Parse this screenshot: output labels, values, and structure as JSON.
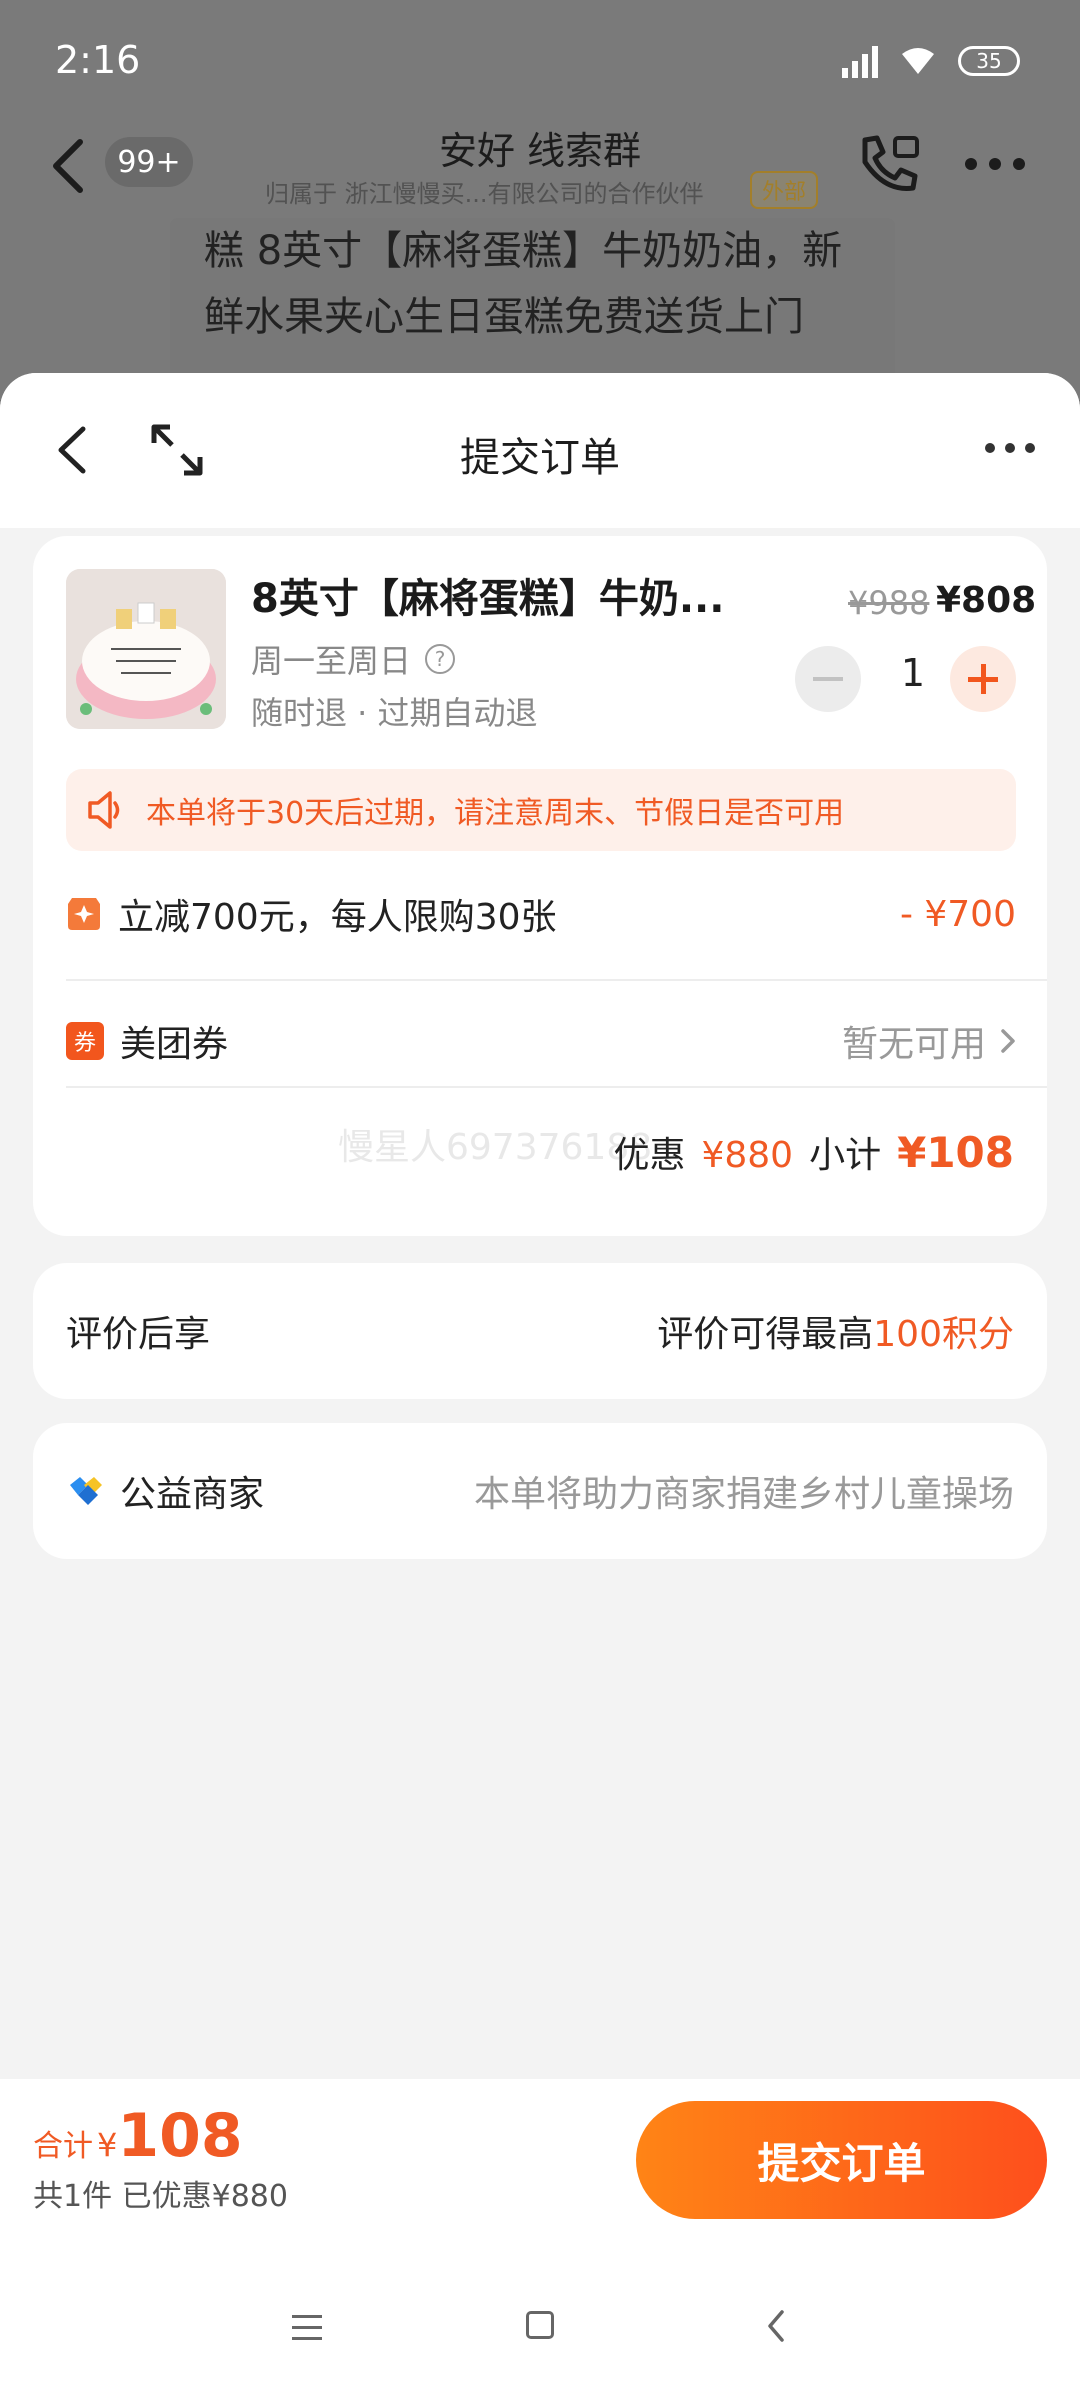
{
  "status_bar": {
    "time": "2:16",
    "battery": "35"
  },
  "chat": {
    "unread_count": "99+",
    "title": "安好 线索群",
    "subtitle": "归属于 浙江慢慢买...有限公司的合作伙伴",
    "external_tag": "外部",
    "bubble_text": "糕 8英寸【麻将蛋糕】牛奶奶油，新鲜水果夹心生日蛋糕免费送货上门"
  },
  "sheet": {
    "title": "提交订单"
  },
  "product": {
    "name": "8英寸【麻将蛋糕】牛奶...",
    "availability": "周一至周日",
    "refund_policy": "随时退 · 过期自动退",
    "original_price": "¥988",
    "price": "¥808",
    "quantity": "1"
  },
  "notice": "本单将于30天后过期，请注意周末、节假日是否可用",
  "discount": {
    "label": "立减700元，每人限购30张",
    "amount": "- ¥700"
  },
  "coupon": {
    "label": "美团券",
    "status": "暂无可用"
  },
  "summary": {
    "watermark": "慢星人697376188",
    "discount_label": "优惠",
    "discount_value": "¥880",
    "subtotal_label": "小计",
    "subtotal_value": "¥108"
  },
  "review": {
    "label": "评价后享",
    "right_prefix": "评价可得最高",
    "right_highlight": "100积分"
  },
  "charity": {
    "label": "公益商家",
    "description": "本单将助力商家捐建乡村儿童操场"
  },
  "footer": {
    "total_label": "合计",
    "currency": "¥",
    "total_value": "108",
    "count_saved": "共1件  已优惠¥880",
    "submit_label": "提交订单"
  },
  "colors": {
    "accent": "#f05a24",
    "button_start": "#ff8416",
    "button_end": "#fe4f1c"
  },
  "icons": [
    "back-icon",
    "expand-icon",
    "more-icon",
    "help-icon",
    "minus-icon",
    "plus-icon",
    "speaker-icon",
    "discount-badge-icon",
    "coupon-badge-icon",
    "chevron-right-icon",
    "charity-icon",
    "phone-icon"
  ]
}
